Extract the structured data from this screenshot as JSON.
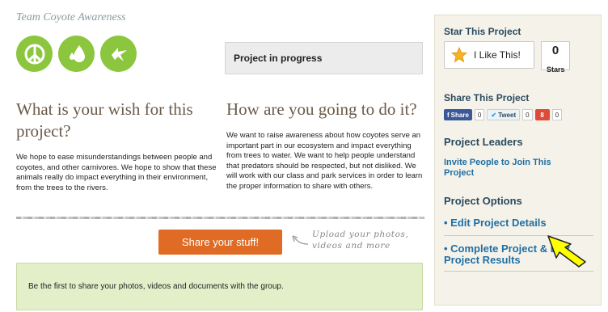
{
  "team_name": "Team Coyote Awareness",
  "badges": [
    {
      "icon": "peace-icon"
    },
    {
      "icon": "water-drops-icon"
    },
    {
      "icon": "bird-icon"
    }
  ],
  "status": "Project in progress",
  "wish": {
    "heading": "What is your wish for this project?",
    "text": "We hope to ease misunderstandings between people and coyotes, and other carnivores. We hope to show that these animals really do impact everything in their environment, from the trees to the rivers."
  },
  "how": {
    "heading": "How are you going to do it?",
    "text": "We want to raise awareness about how coyotes serve an important part in our ecosystem and impact everything from trees to water. We want to help people understand that predators should be respected, but not disliked. We will work with our class and park services in order to learn the proper information to share with others."
  },
  "share_button": "Share your stuff!",
  "upload_hint": "Upload your photos, videos and more",
  "first_share_text": "Be the first to share your photos, videos and documents with the group.",
  "sidebar": {
    "star_title": "Star This Project",
    "like_label": "I Like This!",
    "stars_count": "0",
    "stars_label": "Stars",
    "share_title": "Share This Project",
    "social": {
      "fb_label": "Share",
      "fb_count": "0",
      "tw_label": "Tweet",
      "tw_count": "0",
      "gp_count": "0"
    },
    "leaders_title": "Project Leaders",
    "invite_label": "Invite People to Join This Project",
    "options_title": "Project Options",
    "options": [
      "• Edit Project Details",
      "• Complete Project & Edit Project Results"
    ]
  },
  "colors": {
    "badge_green": "#8cc63f",
    "share_orange": "#e06b24",
    "link_blue": "#1f6fa3",
    "pointer_yellow": "#ffff00"
  }
}
